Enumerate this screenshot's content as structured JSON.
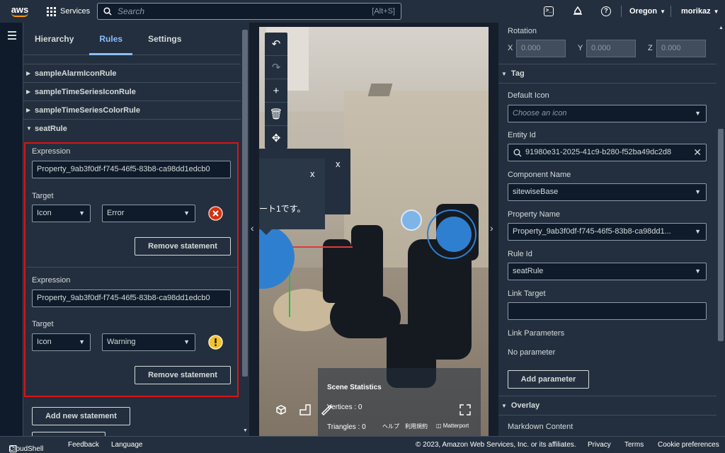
{
  "topnav": {
    "logo_text": "aws",
    "services_label": "Services",
    "search_placeholder": "Search",
    "search_shortcut": "[Alt+S]",
    "region": "Oregon",
    "user": "morikaz",
    "icons": [
      "cloudshell-icon",
      "notifications-icon",
      "help-icon"
    ]
  },
  "left": {
    "tabs": [
      "Hierarchy",
      "Rules",
      "Settings"
    ],
    "active_tab": "Rules",
    "rules": [
      "sampleAlarmIconRule",
      "sampleTimeSeriesIconRule",
      "sampleTimeSeriesColorRule",
      "seatRule"
    ],
    "statements": [
      {
        "expression_label": "Expression",
        "expression": "Property_9ab3f0df-f745-46f5-83b8-ca98dd1edcb0",
        "target_label": "Target",
        "target_type": "Icon",
        "target_value": "Error",
        "icon": "error-icon",
        "remove_label": "Remove statement"
      },
      {
        "expression_label": "Expression",
        "expression": "Property_9ab3f0df-f745-46f5-83b8-ca98dd1edcb0",
        "target_label": "Target",
        "target_type": "Icon",
        "target_value": "Warning",
        "icon": "warning-icon",
        "remove_label": "Remove statement"
      }
    ],
    "add_statement_label": "Add new statement"
  },
  "scene": {
    "popup_text": "ート1です。",
    "close1": "x",
    "close2": "x",
    "stats_title": "Scene Statistics",
    "vertices": "Vertices : 0",
    "triangles": "Triangles : 0",
    "help_link": "ヘルプ",
    "terms_link": "利用規約",
    "matterport": "Matterport"
  },
  "right": {
    "rotation_label": "Rotation",
    "rotation_x_label": "X",
    "rotation_y_label": "Y",
    "rotation_z_label": "Z",
    "rotation_x": "0.000",
    "rotation_y": "0.000",
    "rotation_z": "0.000",
    "tag_section": "Tag",
    "default_icon_label": "Default Icon",
    "default_icon_placeholder": "Choose an icon",
    "entity_id_label": "Entity Id",
    "entity_id": "91980e31-2025-41c9-b280-f52ba49dc2d8",
    "component_name_label": "Component Name",
    "component_name": "sitewiseBase",
    "property_name_label": "Property Name",
    "property_name": "Property_9ab3f0df-f745-46f5-83b8-ca98dd1...",
    "rule_id_label": "Rule Id",
    "rule_id": "seatRule",
    "link_target_label": "Link Target",
    "link_target": "",
    "link_params_label": "Link Parameters",
    "no_parameter": "No parameter",
    "add_parameter_label": "Add parameter",
    "overlay_section": "Overlay",
    "markdown_label": "Markdown Content"
  },
  "footer": {
    "cloudshell": "CloudShell",
    "feedback": "Feedback",
    "language": "Language",
    "copyright": "© 2023, Amazon Web Services, Inc. or its affiliates.",
    "privacy": "Privacy",
    "terms": "Terms",
    "cookie": "Cookie preferences"
  },
  "colors": {
    "nav": "#232f3e",
    "accent": "#89bdff",
    "highlight": "#d91515",
    "error": "#d13212",
    "warning": "#f2c12e"
  }
}
